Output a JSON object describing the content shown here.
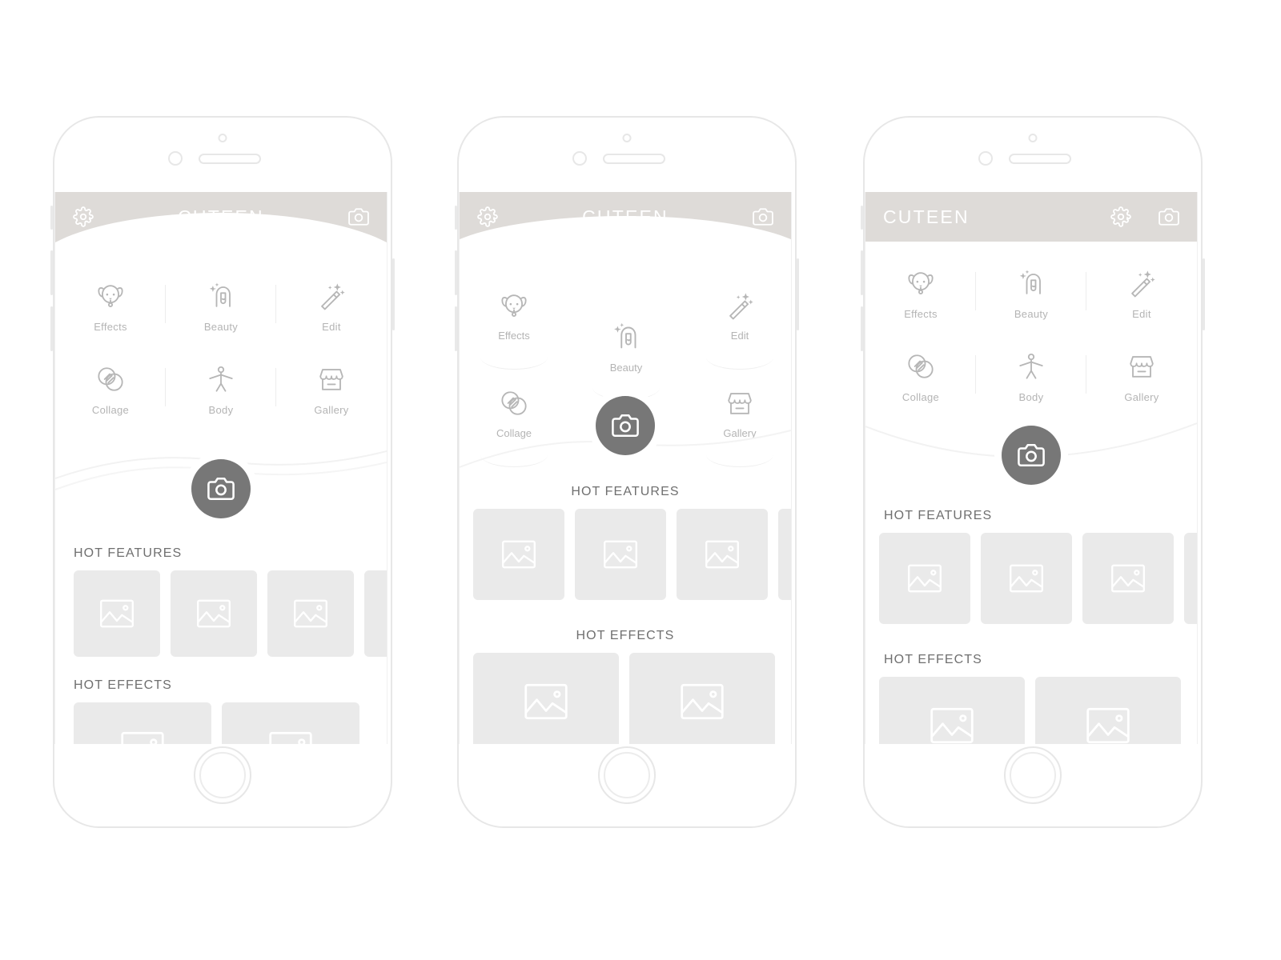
{
  "app": {
    "name": "CUTEEN",
    "accent_dark": "#777777",
    "header_bg": "#dedbd8",
    "card_bg": "#eaeaea",
    "label_color": "#b4b4b4",
    "section_color": "#6f6f6f"
  },
  "icons": {
    "settings": "gear-icon",
    "camera": "camera-icon",
    "shutter": "camera-shutter-icon",
    "placeholder": "image-placeholder-icon",
    "effects": "dog-face-icon",
    "beauty": "woman-sparkle-icon",
    "edit": "magic-wand-icon",
    "collage": "overlapping-circles-icon",
    "body": "person-icon",
    "gallery": "storefront-icon"
  },
  "features": [
    {
      "id": "effects",
      "label": "Effects"
    },
    {
      "id": "beauty",
      "label": "Beauty"
    },
    {
      "id": "edit",
      "label": "Edit"
    },
    {
      "id": "collage",
      "label": "Collage"
    },
    {
      "id": "body",
      "label": "Body"
    },
    {
      "id": "gallery",
      "label": "Gallery"
    }
  ],
  "sections": {
    "hot_features": "HOT FEATURES",
    "hot_effects": "HOT EFFECTS"
  },
  "screens": [
    {
      "id": "variant-a",
      "title": "CUTEEN",
      "header_layout": "gear-left-title-center-camera-right",
      "header_style": "curved",
      "title_align": "center",
      "section_align": "left",
      "feature_layout": "grid-3x2-with-dividers",
      "hot_features_cards": 4,
      "hot_effects_cards": 2
    },
    {
      "id": "variant-b",
      "title": "CUTEEN",
      "header_layout": "gear-left-title-center-camera-right",
      "header_style": "curved-shallow",
      "title_align": "center",
      "section_align": "center",
      "feature_layout": "arc-scatter-with-underlines",
      "hot_features_cards": 4,
      "hot_effects_cards": 2
    },
    {
      "id": "variant-c",
      "title": "CUTEEN",
      "header_layout": "title-left-gear-camera-right",
      "header_style": "flat",
      "title_align": "left",
      "section_align": "left",
      "feature_layout": "grid-3x2-with-dividers",
      "hot_features_cards": 4,
      "hot_effects_cards": 2
    }
  ]
}
